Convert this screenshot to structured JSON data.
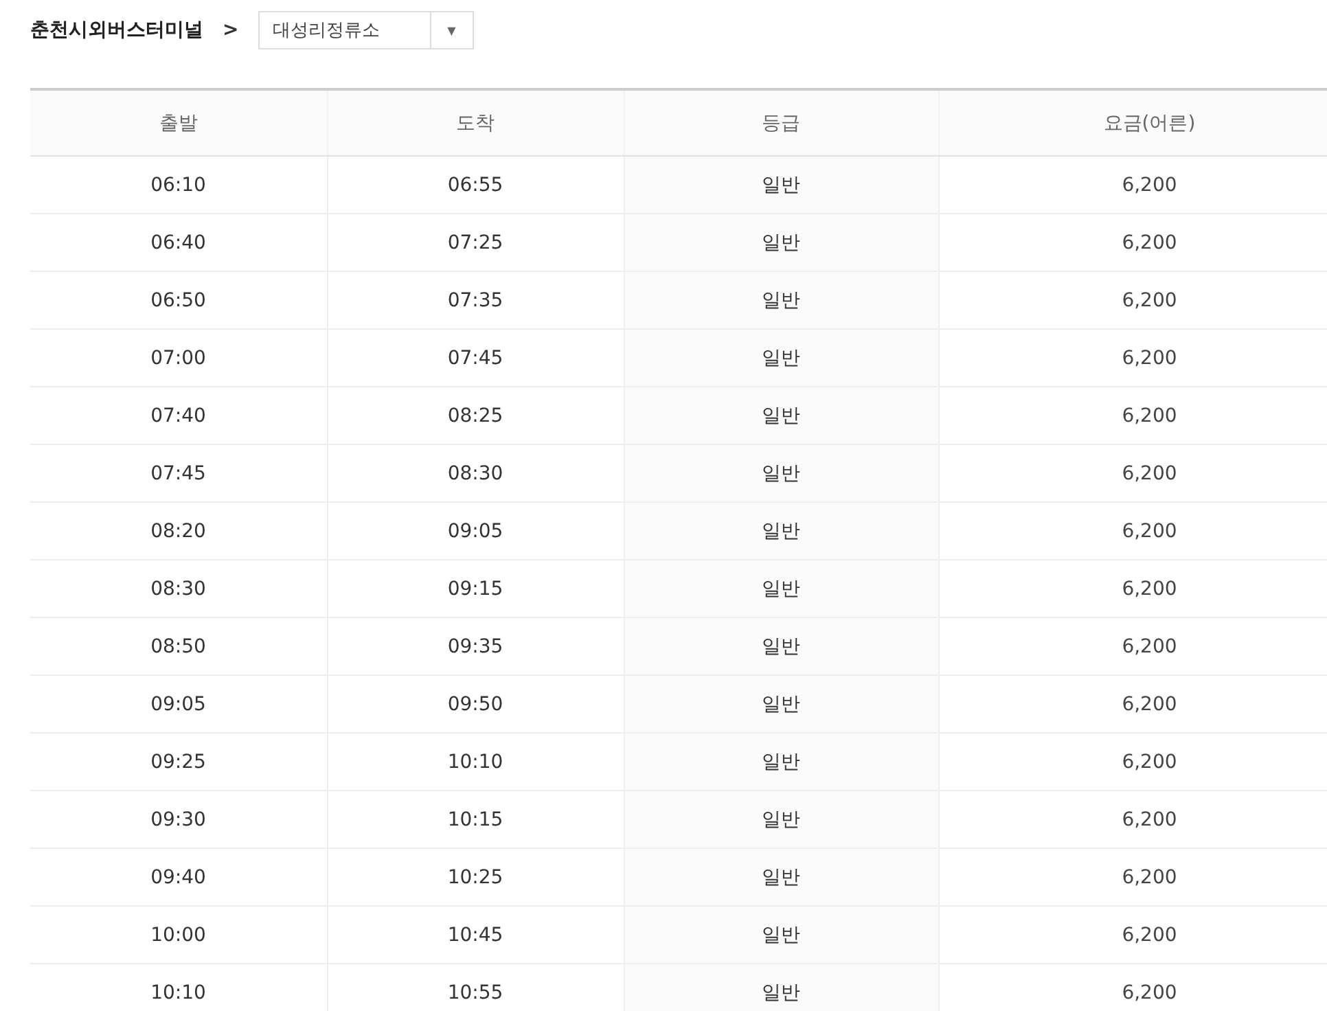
{
  "breadcrumb": {
    "origin": "춘천시외버스터미널",
    "separator": ">",
    "stop_select": {
      "value": "대성리정류소",
      "caret": "▼"
    }
  },
  "table": {
    "columns": [
      "출발",
      "도착",
      "등급",
      "요금(어른)"
    ],
    "rows": [
      [
        "06:10",
        "06:55",
        "일반",
        "6,200"
      ],
      [
        "06:40",
        "07:25",
        "일반",
        "6,200"
      ],
      [
        "06:50",
        "07:35",
        "일반",
        "6,200"
      ],
      [
        "07:00",
        "07:45",
        "일반",
        "6,200"
      ],
      [
        "07:40",
        "08:25",
        "일반",
        "6,200"
      ],
      [
        "07:45",
        "08:30",
        "일반",
        "6,200"
      ],
      [
        "08:20",
        "09:05",
        "일반",
        "6,200"
      ],
      [
        "08:30",
        "09:15",
        "일반",
        "6,200"
      ],
      [
        "08:50",
        "09:35",
        "일반",
        "6,200"
      ],
      [
        "09:05",
        "09:50",
        "일반",
        "6,200"
      ],
      [
        "09:25",
        "10:10",
        "일반",
        "6,200"
      ],
      [
        "09:30",
        "10:15",
        "일반",
        "6,200"
      ],
      [
        "09:40",
        "10:25",
        "일반",
        "6,200"
      ],
      [
        "10:00",
        "10:45",
        "일반",
        "6,200"
      ],
      [
        "10:10",
        "10:55",
        "일반",
        "6,200"
      ]
    ]
  }
}
